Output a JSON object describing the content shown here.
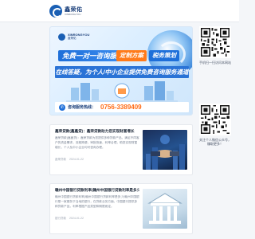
{
  "header": {
    "logo_cn": "鑫荣佑",
    "logo_en": "XINRONGYOU"
  },
  "banner": {
    "brand_en": "XINRONGYOU",
    "brand_cn": "鑫荣佑",
    "main_badge": "免费一对一咨询服务",
    "plan_badge": "定制方案",
    "tax_badge": "税务策划",
    "slogan": "在线答疑，为个人/中小企业提供免费咨询服务通道",
    "hotline_label": "咨询服务热线：",
    "hotline_number": "0756-3389409"
  },
  "sidebar": {
    "qr1_caption": "手机扫一扫访问本网站",
    "qr2_caption": "关注个人微信公众号，赚取更多！"
  },
  "posts": [
    {
      "title": "鑫荣贷款(鑫鑫贷)：鑫荣贷款助力您实现财富增长",
      "excerpt": "鑫荣贷款(鑫鑫贷)：鑫荣贷款为您提供多种贷款产品，满足不同客户的资金需求，流程简便，审批快速，利率合理，助您实现财富增长，个人及中小企业均可咨询办理。",
      "category": "鑫荣贷款",
      "date": "2024-01-22"
    },
    {
      "title": "赣州中国银行贷款利率(赣州中国银行贷款利率是多少)",
      "excerpt": "赣州中国银行贷款利率(赣州中国银行贷款利率是多少)赣州中国银行是一家服务于当地的银行，在贷款业务方面，中国银行提供多种贷款产品，利率根据产品类型和期限而定。",
      "category": "银行贷款",
      "date": "2024-01-22"
    }
  ],
  "colors": {
    "brand_blue": "#1a5fb4",
    "accent_orange": "#ff7a1a"
  }
}
